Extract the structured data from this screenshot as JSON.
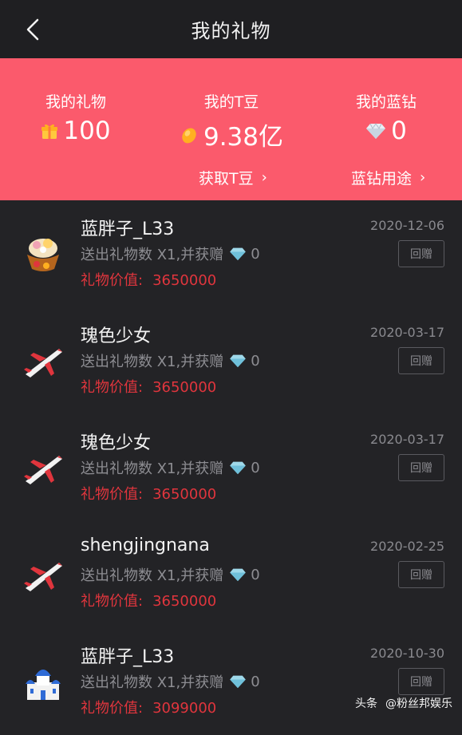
{
  "header": {
    "title": "我的礼物",
    "back_icon": "chevron-left-icon"
  },
  "summary": {
    "gifts": {
      "label": "我的礼物",
      "value": "100",
      "icon": "gift-icon"
    },
    "tbeans": {
      "label": "我的T豆",
      "value": "9.38亿",
      "icon": "bean-icon"
    },
    "diamonds": {
      "label": "我的蓝钻",
      "value": "0",
      "icon": "diamond-icon"
    },
    "get_tbeans_link": "获取T豆",
    "diamond_usage_link": "蓝钻用途",
    "background_color": "#fb5a6c"
  },
  "gift_records": [
    {
      "sender": "蓝胖子_L33",
      "date": "2020-12-06",
      "desc": "送出礼物数 X1,并获赠",
      "diamonds": "0",
      "price_label": "礼物价值:",
      "price": "3650000",
      "reply_label": "回赠",
      "gift_icon": "treasure-basket-icon"
    },
    {
      "sender": "瑰色少女",
      "date": "2020-03-17",
      "desc": "送出礼物数 X1,并获赠",
      "diamonds": "0",
      "price_label": "礼物价值:",
      "price": "3650000",
      "reply_label": "回赠",
      "gift_icon": "airplane-icon"
    },
    {
      "sender": "瑰色少女",
      "date": "2020-03-17",
      "desc": "送出礼物数 X1,并获赠",
      "diamonds": "0",
      "price_label": "礼物价值:",
      "price": "3650000",
      "reply_label": "回赠",
      "gift_icon": "airplane-icon"
    },
    {
      "sender": "shengjingnana",
      "date": "2020-02-25",
      "desc": "送出礼物数 X1,并获赠",
      "diamonds": "0",
      "price_label": "礼物价值:",
      "price": "3650000",
      "reply_label": "回赠",
      "gift_icon": "airplane-icon"
    },
    {
      "sender": "蓝胖子_L33",
      "date": "2020-10-30",
      "desc": "送出礼物数 X1,并获赠",
      "diamonds": "0",
      "price_label": "礼物价值:",
      "price": "3099000",
      "reply_label": "回赠",
      "gift_icon": "castle-icon"
    }
  ],
  "watermark": {
    "source": "头条",
    "account": "@粉丝邦娱乐"
  },
  "colors": {
    "price": "#e0353d",
    "muted": "#8d8d92",
    "background": "#232326"
  }
}
